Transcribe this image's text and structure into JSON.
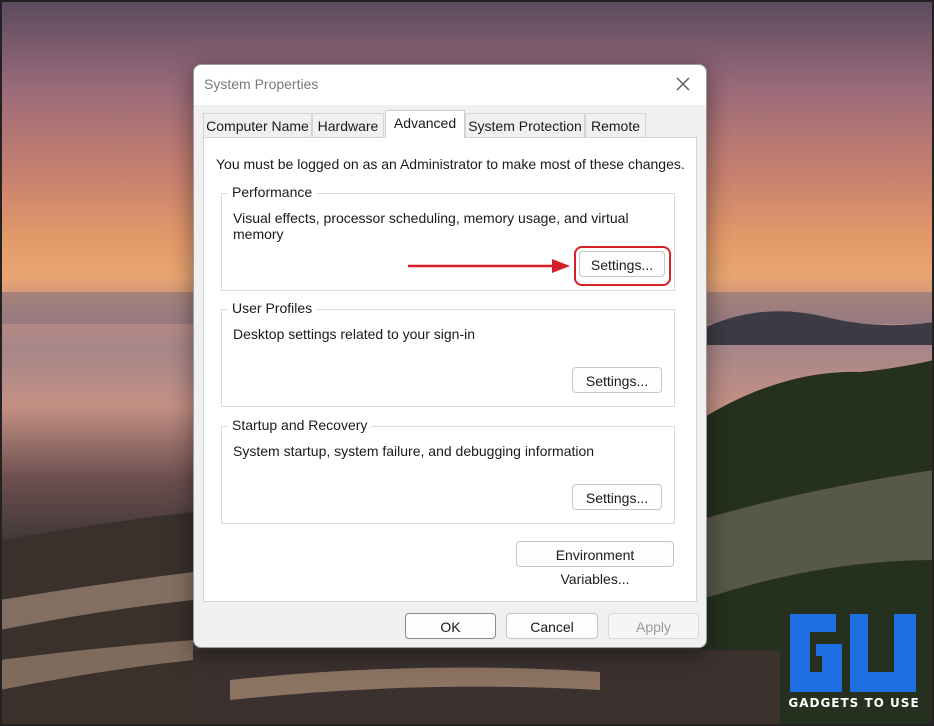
{
  "dialog": {
    "title": "System Properties",
    "tabs": [
      {
        "label": "Computer Name"
      },
      {
        "label": "Hardware"
      },
      {
        "label": "Advanced"
      },
      {
        "label": "System Protection"
      },
      {
        "label": "Remote"
      }
    ],
    "active_tab": "Advanced",
    "notice": "You must be logged on as an Administrator to make most of these changes.",
    "groups": [
      {
        "title": "Performance",
        "description": "Visual effects, processor scheduling, memory usage, and virtual memory",
        "button": "Settings..."
      },
      {
        "title": "User Profiles",
        "description": "Desktop settings related to your sign-in",
        "button": "Settings..."
      },
      {
        "title": "Startup and Recovery",
        "description": "System startup, system failure, and debugging information",
        "button": "Settings..."
      }
    ],
    "env_button": "Environment Variables...",
    "footer": {
      "ok": "OK",
      "cancel": "Cancel",
      "apply": "Apply"
    }
  },
  "annotation": {
    "color": "#d62027"
  },
  "watermark": {
    "text": "GADGETS TO USE",
    "color": "#1e6fe0"
  }
}
